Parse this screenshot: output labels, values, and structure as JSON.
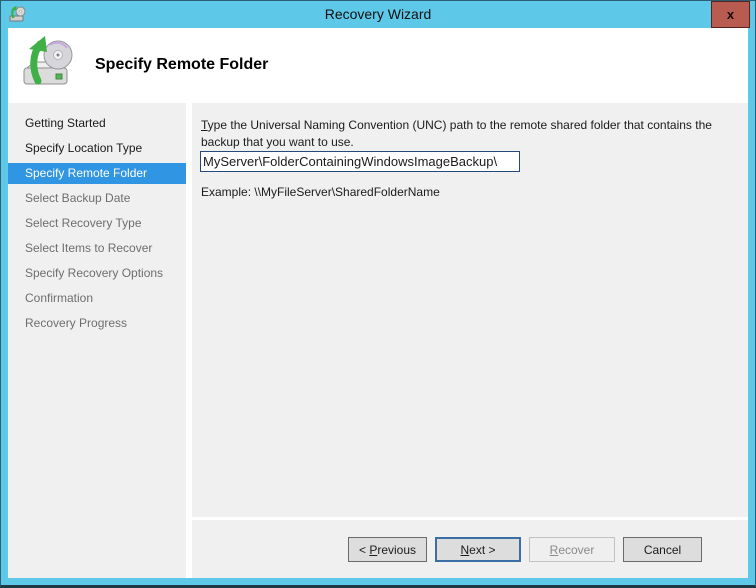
{
  "window": {
    "title": "Recovery Wizard",
    "close_glyph": "x"
  },
  "header": {
    "title": "Specify Remote Folder"
  },
  "sidebar": {
    "steps": [
      {
        "label": "Getting Started",
        "state": "done"
      },
      {
        "label": "Specify Location Type",
        "state": "done"
      },
      {
        "label": "Specify Remote Folder",
        "state": "current"
      },
      {
        "label": "Select Backup Date",
        "state": "upcoming"
      },
      {
        "label": "Select Recovery Type",
        "state": "upcoming"
      },
      {
        "label": "Select Items to Recover",
        "state": "upcoming"
      },
      {
        "label": "Specify Recovery Options",
        "state": "upcoming"
      },
      {
        "label": "Confirmation",
        "state": "upcoming"
      },
      {
        "label": "Recovery Progress",
        "state": "upcoming"
      }
    ]
  },
  "main": {
    "instruction": {
      "access_key": "T",
      "rest": "ype the Universal Naming Convention (UNC) path to the remote shared folder that contains the\nbackup that you want to use."
    },
    "unc_input": {
      "value": "MyServer\\FolderContainingWindowsImageBackup\\"
    },
    "example": "Example: \\\\MyFileServer\\SharedFolderName"
  },
  "buttons": {
    "previous": {
      "pre": "< ",
      "access_key": "P",
      "post": "revious"
    },
    "next": {
      "pre": "",
      "access_key": "N",
      "post": "ext >"
    },
    "recover": {
      "pre": "",
      "access_key": "R",
      "post": "ecover"
    },
    "cancel": {
      "label": "Cancel"
    }
  },
  "colors": {
    "titlebar_blue": "#5ec8e8",
    "step_highlight": "#3095e2",
    "close_button_red": "#b85c52",
    "body_gray": "#f0f0f0",
    "default_button_border": "#3a6ea5"
  }
}
